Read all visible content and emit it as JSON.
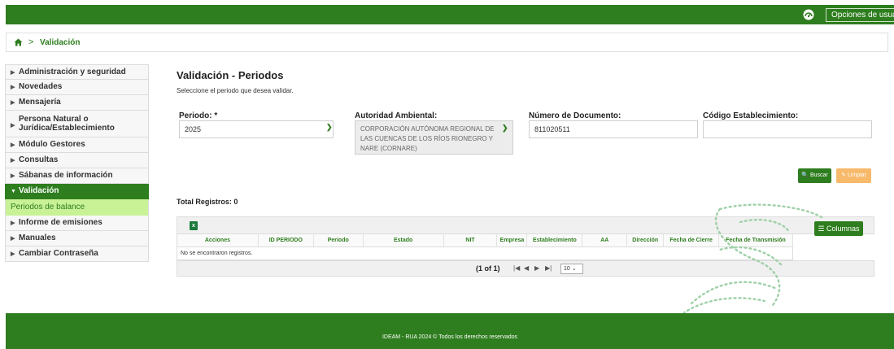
{
  "header": {
    "user_options_label": "Opciones de usuario ⌄",
    "icons": [
      "gauge-icon",
      "home-icon"
    ]
  },
  "breadcrumb": {
    "separator": ">",
    "current": "Validación"
  },
  "sidebar": {
    "items": [
      {
        "label": "Administración y seguridad"
      },
      {
        "label": "Novedades"
      },
      {
        "label": "Mensajería"
      },
      {
        "label": "Persona Natural o Jurídica/Establecimiento"
      },
      {
        "label": "Módulo Gestores"
      },
      {
        "label": "Consultas"
      },
      {
        "label": "Sábanas de información"
      },
      {
        "label": "Validación",
        "sub": "Periodos de balance"
      },
      {
        "label": "Informe de emisiones"
      },
      {
        "label": "Manuales"
      },
      {
        "label": "Cambiar Contraseña"
      }
    ]
  },
  "main": {
    "title": "Validación - Periodos",
    "subtitle": "Seleccione el periodo que desea validar.",
    "fields": {
      "periodo": {
        "label": "Periodo: *",
        "value": "2025"
      },
      "autoridad": {
        "label": "Autoridad Ambiental:",
        "value": "CORPORACIÓN AUTÓNOMA REGIONAL DE LAS CUENCAS DE LOS RÍOS RIONEGRO Y NARE (CORNARE)"
      },
      "documento": {
        "label": "Número de Documento:",
        "value": "811020511"
      },
      "establecimiento": {
        "label": "Código Establecimiento:",
        "value": ""
      }
    },
    "buttons": {
      "buscar": "Buscar",
      "limpiar": "Limpiar",
      "columnas": "Columnas"
    },
    "total_registros": "Total Registros: 0",
    "table": {
      "columns": [
        "Acciones",
        "ID PERIODO",
        "Periodo",
        "Estado",
        "NIT",
        "Empresa",
        "Establecimiento",
        "AA",
        "Dirección",
        "Fecha de Cierre",
        "Fecha de Transmisión"
      ],
      "empty_message": "No se encontraron registros.",
      "paginator": {
        "info": "(1 of 1)",
        "rows_per_page": "10 ⌄"
      }
    }
  },
  "footer": {
    "text": "IDEAM - RUA 2024 © Todos los derechos reservados"
  },
  "colors": {
    "primary": "#2e7d1e",
    "submenu": "#c9f297",
    "limpiar": "#f7b96a"
  }
}
